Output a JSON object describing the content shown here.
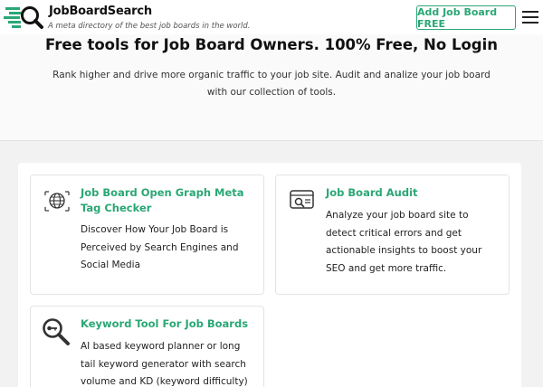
{
  "header": {
    "brand": "JobBoardSearch",
    "tagline": "A meta directory of the best job boards in the world.",
    "add_button": "Add Job Board FREE"
  },
  "hero": {
    "title": "Free tools for Job Board Owners. 100% Free, No Login",
    "description": "Rank higher and drive more organic traffic to your job site. Audit and analize your job board with our collection of tools."
  },
  "tools": [
    {
      "icon": "globe-icon",
      "title": "Job Board Open Graph Meta Tag Checker",
      "description": "Discover How Your Job Board is Perceived by Search Engines and Social Media"
    },
    {
      "icon": "audit-icon",
      "title": "Job Board Audit",
      "description": "Analyze your job board site to detect critical errors and get actionable insights to boost your SEO and get more traffic."
    },
    {
      "icon": "key-icon",
      "title": "Keyword Tool For Job Boards",
      "description": "AI based keyword planner or long tail keyword generator with search volume and KD (keyword difficulty)"
    }
  ],
  "colors": {
    "accent": "#2aa775",
    "text": "#222222"
  }
}
